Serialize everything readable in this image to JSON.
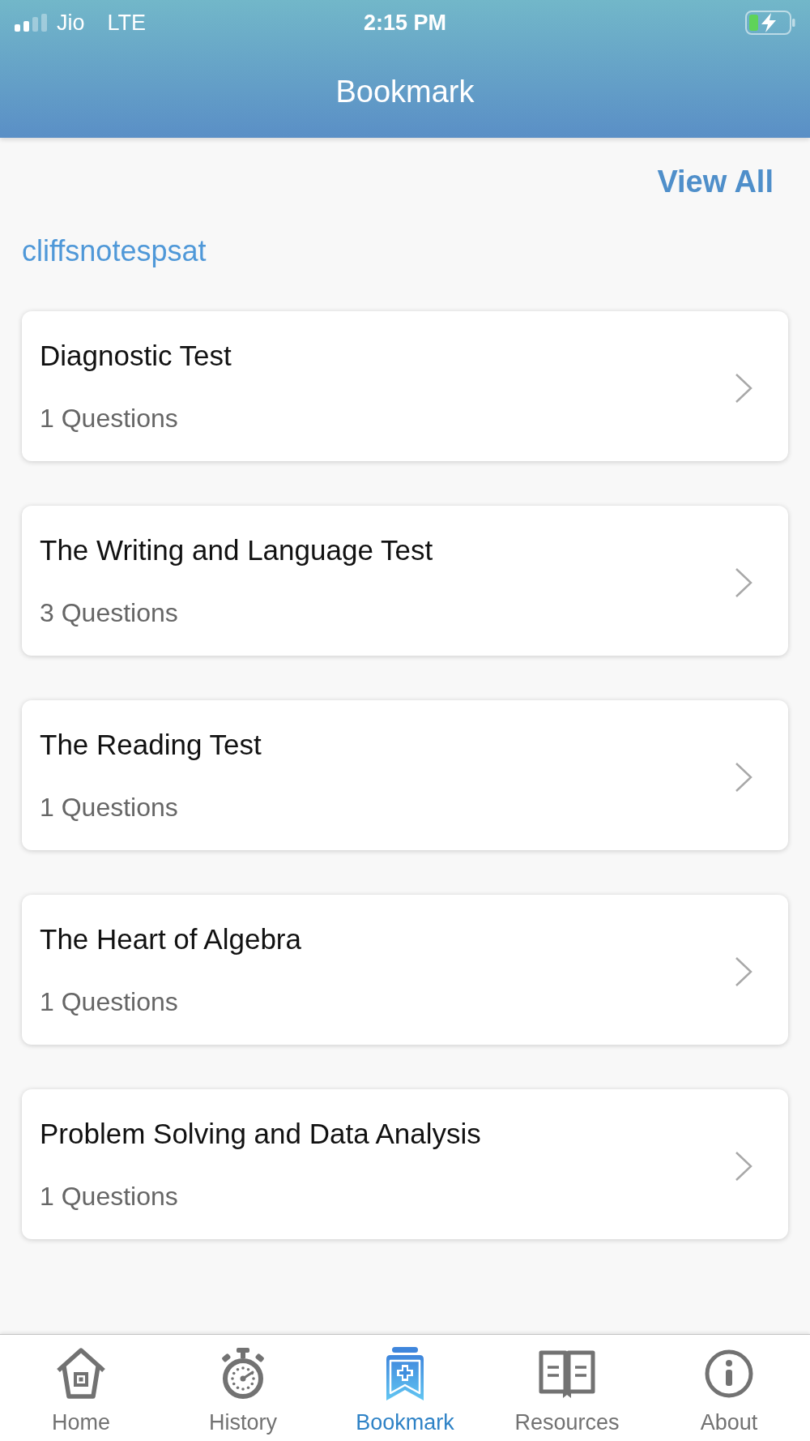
{
  "status_bar": {
    "carrier": "Jio",
    "network": "LTE",
    "time": "2:15 PM"
  },
  "header": {
    "title": "Bookmark"
  },
  "view_all": "View All",
  "section_title": "cliffsnotespsat",
  "bookmarks": [
    {
      "title": "Diagnostic Test",
      "count": "1 Questions"
    },
    {
      "title": "The Writing and Language Test",
      "count": "3 Questions"
    },
    {
      "title": "The Reading Test",
      "count": "1 Questions"
    },
    {
      "title": "The Heart of Algebra",
      "count": "1 Questions"
    },
    {
      "title": "Problem Solving and Data Analysis",
      "count": "1 Questions"
    }
  ],
  "tab_bar": [
    {
      "label": "Home",
      "kind": "home",
      "selected": false
    },
    {
      "label": "History",
      "kind": "history",
      "selected": false
    },
    {
      "label": "Bookmark",
      "kind": "bookmark",
      "selected": true
    },
    {
      "label": "Resources",
      "kind": "resources",
      "selected": false
    },
    {
      "label": "About",
      "kind": "about",
      "selected": false
    }
  ]
}
